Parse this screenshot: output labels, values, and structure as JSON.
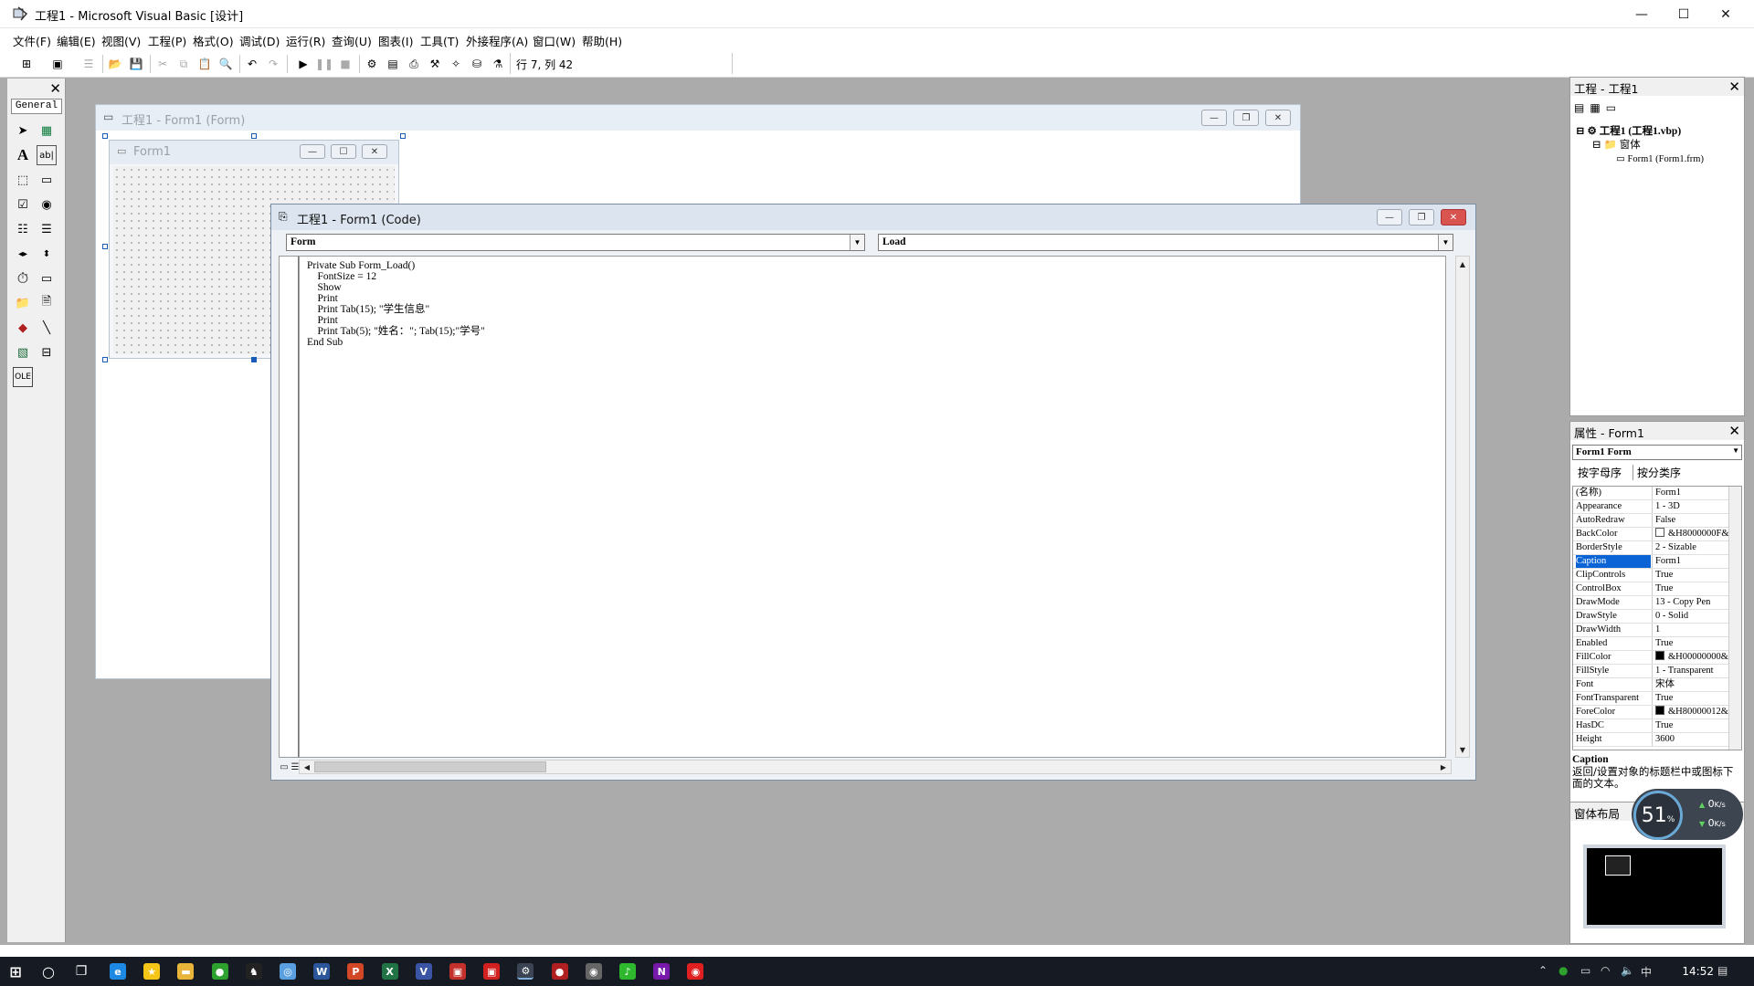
{
  "window": {
    "title": "工程1 - Microsoft Visual Basic [设计]",
    "minimize_glyph": "—",
    "maximize_glyph": "☐",
    "close_glyph": "✕"
  },
  "menu": [
    "文件(F)",
    "编辑(E)",
    "视图(V)",
    "工程(P)",
    "格式(O)",
    "调试(D)",
    "运行(R)",
    "查询(U)",
    "图表(I)",
    "工具(T)",
    "外接程序(A)",
    "窗口(W)",
    "帮助(H)"
  ],
  "toolbar": {
    "position_text": "行 7, 列 42"
  },
  "toolbox": {
    "tab_label": "General",
    "close_glyph": "✕"
  },
  "designer": {
    "title": "工程1 - Form1 (Form)",
    "form_caption": "Form1"
  },
  "code_window": {
    "title": "工程1 - Form1 (Code)",
    "object_combo": "Form",
    "proc_combo": "Load",
    "lines": [
      "Private Sub Form_Load()",
      "    FontSize = 12",
      "    Show",
      "    Print",
      "    Print Tab(15); \"学生信息\"",
      "    Print",
      "    Print Tab(5); \"姓名：\"; Tab(15);\"学号\"",
      "End Sub"
    ]
  },
  "project_panel": {
    "title": "工程 - 工程1",
    "tree": [
      "工程1 (工程1.vbp)",
      "窗体",
      "Form1 (Form1.frm)"
    ]
  },
  "properties_panel": {
    "title": "属性 - Form1",
    "object_selector": "Form1 Form",
    "tabs": [
      "按字母序",
      "按分类序"
    ],
    "rows": [
      {
        "name": "(名称)",
        "value": "Form1"
      },
      {
        "name": "Appearance",
        "value": "1 - 3D"
      },
      {
        "name": "AutoRedraw",
        "value": "False"
      },
      {
        "name": "BackColor",
        "value": "&H8000000F&",
        "swatch": "#ffffff"
      },
      {
        "name": "BorderStyle",
        "value": "2 - Sizable"
      },
      {
        "name": "Caption",
        "value": "Form1",
        "selected": true
      },
      {
        "name": "ClipControls",
        "value": "True"
      },
      {
        "name": "ControlBox",
        "value": "True"
      },
      {
        "name": "DrawMode",
        "value": "13 - Copy Pen"
      },
      {
        "name": "DrawStyle",
        "value": "0 - Solid"
      },
      {
        "name": "DrawWidth",
        "value": "1"
      },
      {
        "name": "Enabled",
        "value": "True"
      },
      {
        "name": "FillColor",
        "value": "&H00000000&",
        "swatch": "#000000"
      },
      {
        "name": "FillStyle",
        "value": "1 - Transparent"
      },
      {
        "name": "Font",
        "value": "宋体"
      },
      {
        "name": "FontTransparent",
        "value": "True"
      },
      {
        "name": "ForeColor",
        "value": "&H80000012&",
        "swatch": "#000000"
      },
      {
        "name": "HasDC",
        "value": "True"
      },
      {
        "name": "Height",
        "value": "3600"
      }
    ],
    "desc_title": "Caption",
    "desc_text": "返回/设置对象的标题栏中或图标下面的文本。"
  },
  "layout_panel": {
    "title": "窗体布局"
  },
  "net_widget": {
    "cpu_percent": "51",
    "percent_sign": "%",
    "up_rate": "0",
    "down_rate": "0",
    "unit": "K/s"
  },
  "taskbar": {
    "ime": "中",
    "time": "14:52",
    "apps": [
      "edge",
      "favorites",
      "explorer",
      "wechat",
      "qq",
      "app1",
      "word",
      "powerpoint",
      "excel",
      "visio",
      "app2",
      "app3",
      "vb6",
      "record",
      "chrome",
      "qq-music",
      "onenote",
      "screen-record"
    ],
    "app_letters": {
      "word": "W",
      "powerpoint": "P",
      "excel": "X",
      "visio": "V",
      "onenote": "N"
    }
  },
  "colors": {
    "selection": "#0a64d6",
    "workspace": "#ababab",
    "taskbar": "#161a22"
  }
}
